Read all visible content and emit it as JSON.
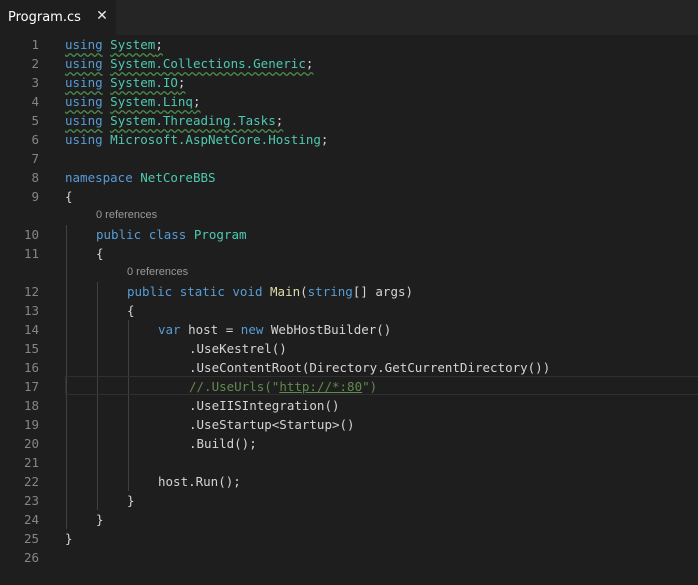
{
  "tab": {
    "filename": "Program.cs",
    "close_glyph": "✕"
  },
  "codelens": {
    "references_10": "0 references",
    "references_12": "0 references"
  },
  "line_numbers": [
    "1",
    "2",
    "3",
    "4",
    "5",
    "6",
    "7",
    "8",
    "9",
    "10",
    "11",
    "12",
    "13",
    "14",
    "15",
    "16",
    "17",
    "18",
    "19",
    "20",
    "21",
    "22",
    "23",
    "24",
    "25",
    "26"
  ],
  "code": {
    "l1": {
      "kw": "using",
      "ns": "System",
      "end": ";"
    },
    "l2": {
      "kw": "using",
      "ns": "System.Collections.Generic",
      "end": ";"
    },
    "l3": {
      "kw": "using",
      "ns": "System.IO",
      "end": ";"
    },
    "l4": {
      "kw": "using",
      "ns": "System.Linq",
      "end": ";"
    },
    "l5": {
      "kw": "using",
      "ns": "System.Threading.Tasks",
      "end": ";"
    },
    "l6": {
      "kw": "using",
      "ns": "Microsoft.AspNetCore.Hosting",
      "end": ";"
    },
    "l8": {
      "kw": "namespace",
      "name": "NetCoreBBS"
    },
    "l9": {
      "text": "{"
    },
    "l10": {
      "kw1": "public",
      "kw2": "class",
      "name": "Program"
    },
    "l11": {
      "text": "{"
    },
    "l12": {
      "kw1": "public",
      "kw2": "static",
      "kw3": "void",
      "fn": "Main",
      "p1": "(",
      "kw4": "string",
      "p2": "[] ",
      "arg": "args",
      "p3": ")"
    },
    "l13": {
      "text": "{"
    },
    "l14": {
      "kw1": "var",
      "mid1": " host = ",
      "kw2": "new",
      "sp": " ",
      "type": "WebHostBuilder",
      "end": "()"
    },
    "l15": {
      "text": ".UseKestrel()"
    },
    "l16": {
      "text": ".UseContentRoot(Directory.GetCurrentDirectory())"
    },
    "l17": {
      "pre": "//.UseUrls(\"",
      "url": "http://*:80",
      "post": "\")"
    },
    "l18": {
      "text": ".UseIISIntegration()"
    },
    "l19": {
      "text": ".UseStartup<Startup>()"
    },
    "l20": {
      "text": ".Build();"
    },
    "l22": {
      "text": "host.Run();"
    },
    "l23": {
      "text": "}"
    },
    "l24": {
      "text": "}"
    },
    "l25": {
      "text": "}"
    }
  },
  "colors": {
    "keyword": "#569cd6",
    "type": "#4ec9b0",
    "function": "#dcdcaa",
    "comment": "#608b4e",
    "default": "#d4d4d4",
    "line_number": "#858585",
    "background": "#1e1e1e"
  }
}
